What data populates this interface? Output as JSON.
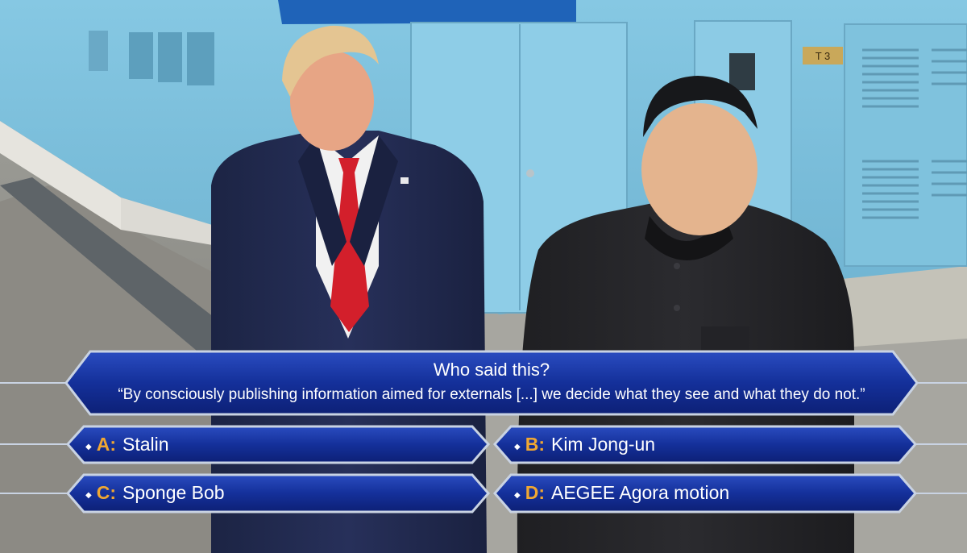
{
  "question": {
    "title": "Who said this?",
    "quote": "“By consciously publishing information aimed for externals [...] we decide what they see and what they do not.”"
  },
  "answers": [
    {
      "letter": "A:",
      "text": "Stalin"
    },
    {
      "letter": "B:",
      "text": "Kim Jong-un"
    },
    {
      "letter": "C:",
      "text": "Sponge Bob"
    },
    {
      "letter": "D:",
      "text": "AEGEE Agora motion"
    }
  ],
  "colors": {
    "panel_blue": "#1c3aa6",
    "panel_border": "#c9d3e3",
    "letter_orange": "#f0a732",
    "wall_blue": "#7fc3df"
  },
  "photo": {
    "door_sign": "T 3"
  }
}
